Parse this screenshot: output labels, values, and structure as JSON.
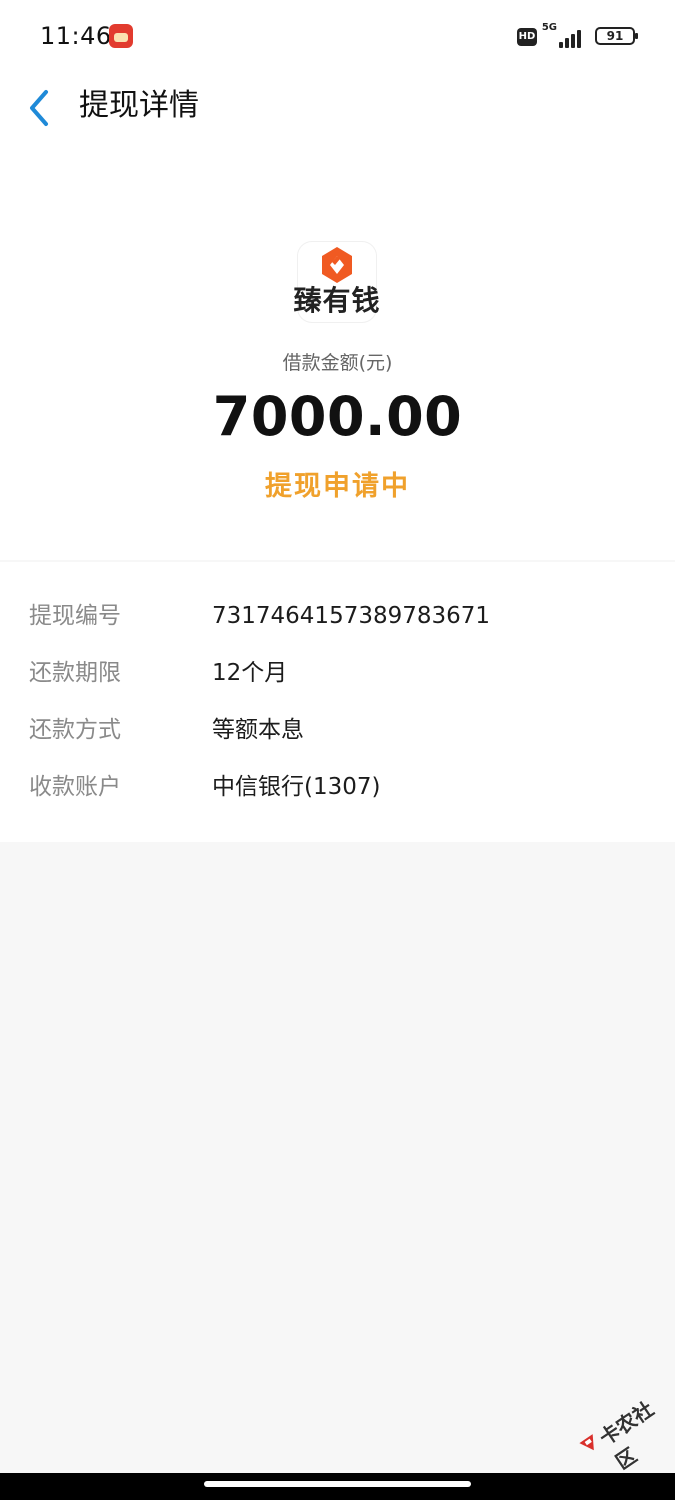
{
  "status_bar": {
    "time": "11:46",
    "hd": "HD",
    "network": "5G",
    "battery": "91"
  },
  "nav": {
    "title": "提现详情"
  },
  "hero": {
    "logo_text": "臻有钱",
    "amount_label": "借款金额(元)",
    "amount": "7000.00",
    "status": "提现申请中",
    "brand_color": "#f05a22",
    "status_color": "#f0a12c"
  },
  "details": {
    "rows": [
      {
        "label": "提现编号",
        "value": "7317464157389783671"
      },
      {
        "label": "还款期限",
        "value": "12个月"
      },
      {
        "label": "还款方式",
        "value": "等额本息"
      },
      {
        "label": "收款账户",
        "value": "中信银行(1307)"
      }
    ]
  },
  "watermark": {
    "text": "卡农社区"
  },
  "icons": {
    "back": "chevron-left-icon",
    "logo": "brand-logo-icon",
    "status_app": "app-notification-icon"
  },
  "accent_color": "#1f8ad8"
}
